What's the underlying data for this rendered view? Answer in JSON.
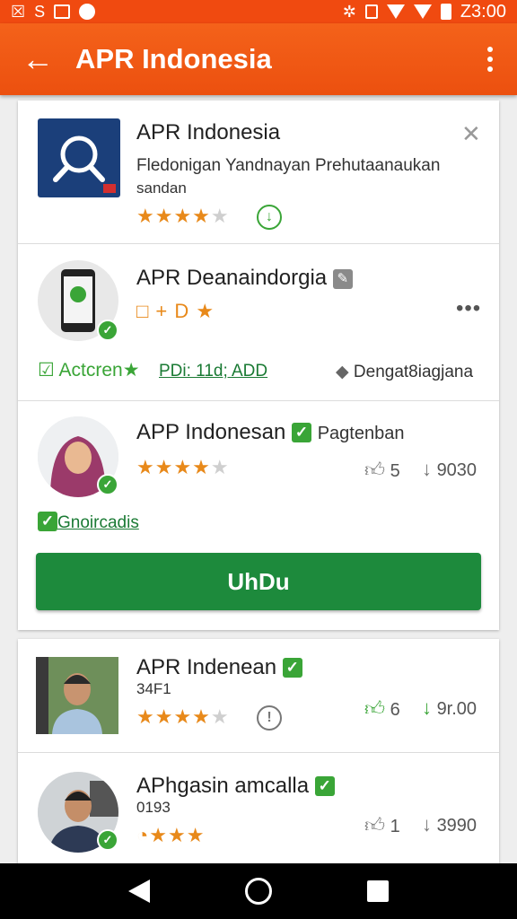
{
  "statusbar": {
    "left_text": "S",
    "time": "Z3:00"
  },
  "appbar": {
    "title": "APR Indonesia"
  },
  "entries": [
    {
      "name": "APR Indonesia",
      "desc1": "Fledonigan Yandnayan Prehutaanaukan",
      "desc2": "sandan",
      "rating": 4,
      "icon": "download-circle-icon"
    },
    {
      "name": "APR Deanaindorgia",
      "row": "□ + D ★",
      "action_label": "Actcren★",
      "link_text": "PDi:  11d; ADD",
      "category": "Dengat8iagjana"
    },
    {
      "name": "APP Indonesan",
      "tag": "Pagtenban",
      "rating": 4,
      "likes": "5",
      "dislikes": "9030",
      "link_text": "Gnoircadis",
      "button_label": "UhDu"
    },
    {
      "name": "APR Indenean",
      "sub": "34F1",
      "rating": 4,
      "likes": "6",
      "dislikes": "9r.00"
    },
    {
      "name": "APhgasin amcalla",
      "sub": "0193",
      "likes": "1",
      "dislikes": "3990"
    }
  ],
  "colors": {
    "accent": "#f04a10",
    "green": "#3aa537",
    "button_green": "#1d8a3c",
    "star": "#e8891a"
  }
}
